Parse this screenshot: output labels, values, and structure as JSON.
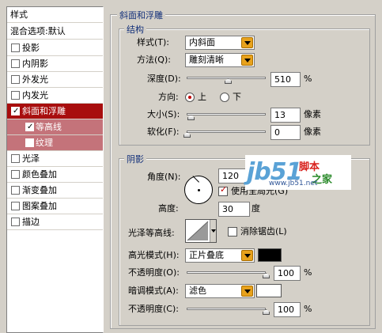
{
  "sidebar": {
    "title": "样式",
    "blend_options": "混合选项:默认",
    "items": [
      {
        "label": "投影",
        "checked": false
      },
      {
        "label": "内阴影",
        "checked": false
      },
      {
        "label": "外发光",
        "checked": false
      },
      {
        "label": "内发光",
        "checked": false
      },
      {
        "label": "斜面和浮雕",
        "checked": true
      },
      {
        "label": "等高线",
        "checked": true
      },
      {
        "label": "纹理",
        "checked": false
      },
      {
        "label": "光泽",
        "checked": false
      },
      {
        "label": "颜色叠加",
        "checked": false
      },
      {
        "label": "渐变叠加",
        "checked": false
      },
      {
        "label": "图案叠加",
        "checked": false
      },
      {
        "label": "描边",
        "checked": false
      }
    ]
  },
  "bevel": {
    "title": "斜面和浮雕",
    "structure": {
      "title": "结构",
      "style_label": "样式(T):",
      "style_value": "内斜面",
      "method_label": "方法(Q):",
      "method_value": "雕刻清晰",
      "depth_label": "深度(D):",
      "depth_value": "510",
      "depth_unit": "%",
      "depth_level": 0.52,
      "direction_label": "方向:",
      "direction_up": "上",
      "direction_down": "下",
      "direction_selected": "up",
      "size_label": "大小(S):",
      "size_value": "13",
      "size_unit": "像素",
      "size_level": 0.05,
      "soften_label": "软化(F):",
      "soften_value": "0",
      "soften_unit": "像素",
      "soften_level": 0
    },
    "shading": {
      "title": "阴影",
      "angle_label": "角度(N):",
      "angle_value": "120",
      "angle_unit": "度",
      "global_light_label": "使用全局光(G)",
      "global_light_checked": true,
      "altitude_label": "高度:",
      "altitude_value": "30",
      "altitude_unit": "度",
      "gloss_label": "光泽等高线:",
      "antialias_label": "消除锯齿(L)",
      "antialias_checked": false,
      "highlight_mode_label": "高光模式(H):",
      "highlight_mode_value": "正片叠底",
      "highlight_color": "#000000",
      "highlight_opacity_label": "不透明度(O):",
      "highlight_opacity_value": "100",
      "highlight_opacity_unit": "%",
      "highlight_opacity_level": 1.0,
      "shadow_mode_label": "暗调模式(A):",
      "shadow_mode_value": "滤色",
      "shadow_color": "#ffffff",
      "shadow_opacity_label": "不透明度(C):",
      "shadow_opacity_value": "100",
      "shadow_opacity_unit": "%",
      "shadow_opacity_level": 1.0
    }
  },
  "watermark": {
    "logo": "jb51",
    "cn_top": "脚本",
    "cn_bottom": "之家",
    "url": "www.jb51.net"
  }
}
